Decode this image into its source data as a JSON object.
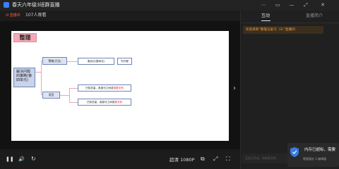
{
  "window": {
    "title": "春天六年级3班群直播",
    "controls": [
      "⋯",
      "▭",
      "—",
      "⤢",
      "✕"
    ]
  },
  "live_bar": {
    "badge": "ıll 直播中",
    "viewers": "107人观看"
  },
  "slide": {
    "title": "整理",
    "root": "解决问题的策略(第四单元)",
    "branch_strategy": "策略(方法)",
    "branch_type": "类型",
    "leaf_1": "假设法(整体法)",
    "leaf_2": "列方程",
    "leaf_3_prefix": "已知总量，",
    "leaf_3_mid": "各部分之间成",
    "leaf_3_hl": "倍数关系",
    "leaf_4_prefix": "已知总量，",
    "leaf_4_mid": "各部分之间成",
    "leaf_4_hl": "差关系",
    "colors": {
      "connector": "#f0a3b5",
      "node_border": "#6f86b8",
      "highlight": "#e0243b"
    }
  },
  "video_nav": {
    "next_icon": "›"
  },
  "controls": {
    "pause_icon": "❚❚",
    "volume_icon": "🔊",
    "refresh_icon": "↻",
    "quality": "超清 1080P",
    "pip_icon": "⧉",
    "expand_icon": "⤢",
    "fullscreen_icon": "⛶"
  },
  "panel": {
    "tab_interact": "互动",
    "tab_intro": "直播简介",
    "welcome": "欢迎来到“整理与复习（3）”直播间",
    "chat_placeholder": "互动已开启，快来发言吧",
    "toast_title": "内存已超标，需要",
    "toast_sub": "需要重启 3 编辑器"
  }
}
